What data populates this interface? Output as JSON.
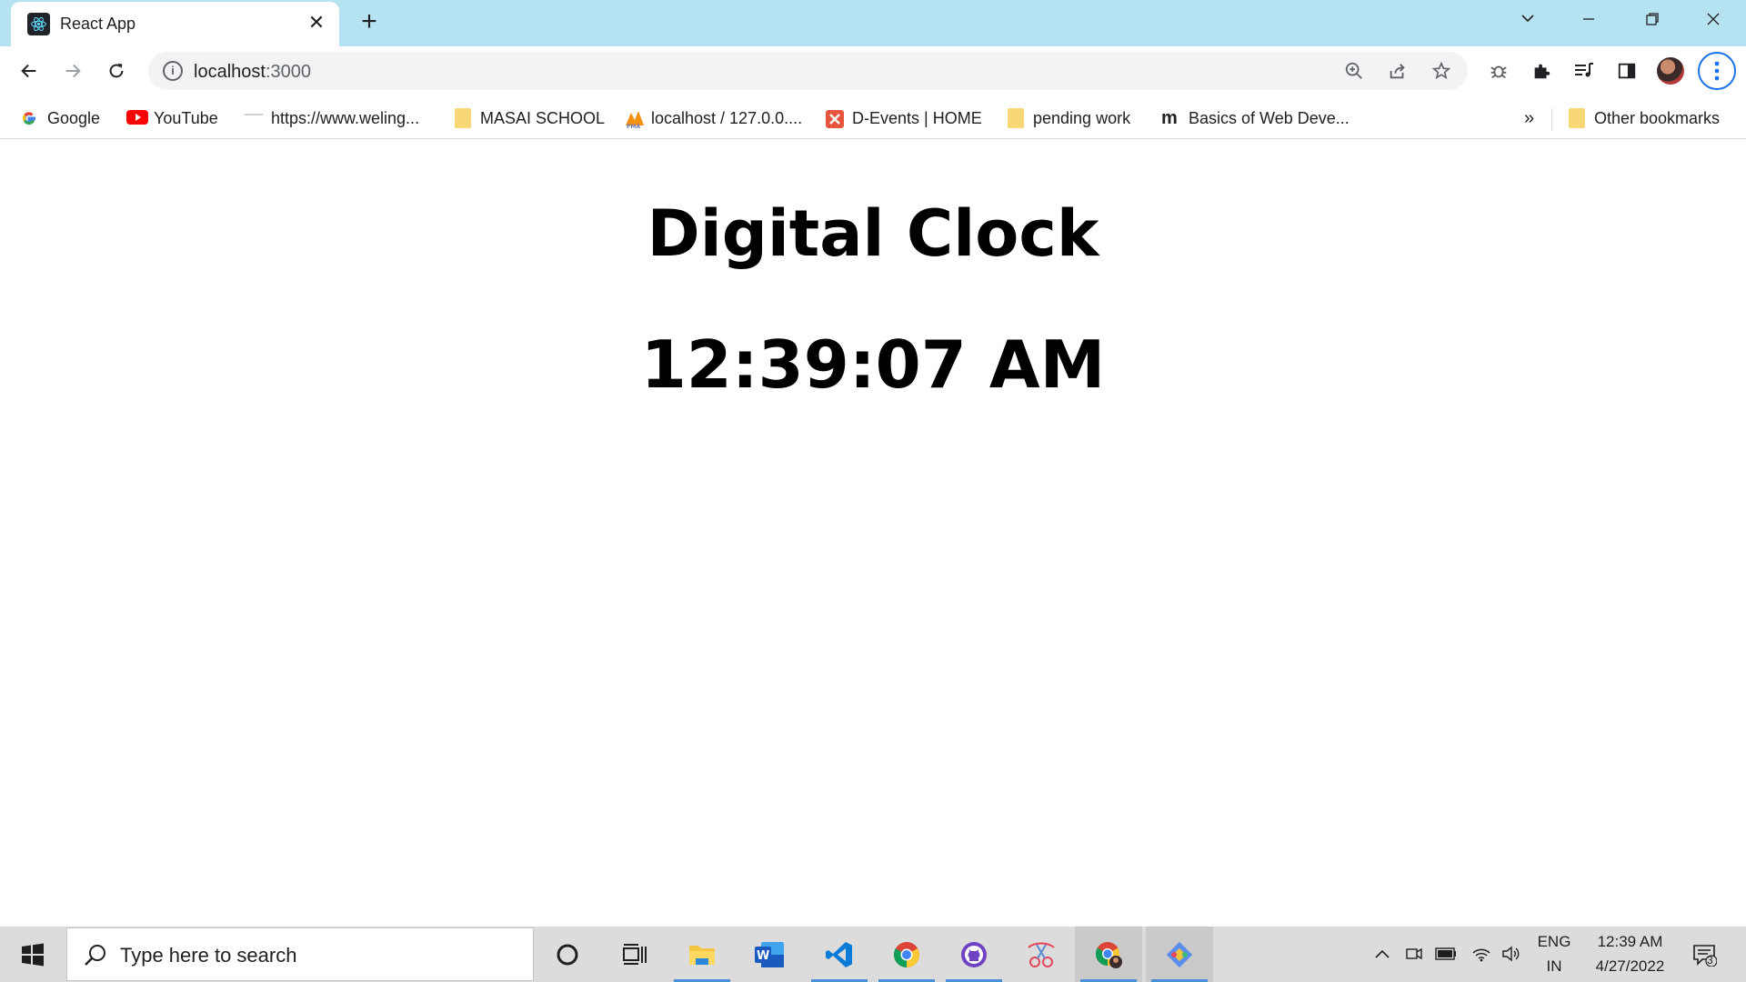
{
  "browser": {
    "tab": {
      "title": "React App"
    },
    "new_tab_label": "+",
    "window_controls": {
      "list": "⌄",
      "minimize": "—",
      "restore": "❐",
      "close": "✕"
    },
    "address": {
      "host": "localhost",
      "port": ":3000"
    },
    "bookmarks": [
      {
        "label": "Google",
        "icon": "google-icon"
      },
      {
        "label": "YouTube",
        "icon": "youtube-icon"
      },
      {
        "label": "https://www.weling...",
        "icon": "site-icon"
      },
      {
        "label": "MASAI SCHOOL",
        "icon": "folder-icon"
      },
      {
        "label": "localhost / 127.0.0....",
        "icon": "phpmyadmin-icon"
      },
      {
        "label": "D-Events | HOME",
        "icon": "d-events-icon"
      },
      {
        "label": "pending work",
        "icon": "folder-icon"
      },
      {
        "label": "Basics of Web Deve...",
        "icon": "medium-icon"
      }
    ],
    "bookmarks_overflow": "»",
    "other_bookmarks": "Other bookmarks"
  },
  "page": {
    "title": "Digital Clock",
    "time": "12:39:07 AM"
  },
  "taskbar": {
    "search_placeholder": "Type here to search",
    "apps": [
      "cortana",
      "task-view",
      "file-explorer",
      "word",
      "vscode",
      "chrome",
      "github-desktop",
      "snipping-tool",
      "chrome-profile",
      "git"
    ],
    "language": {
      "line1": "ENG",
      "line2": "IN"
    },
    "clock": {
      "time": "12:39 AM",
      "date": "4/27/2022"
    },
    "notification_count": "3"
  },
  "colors": {
    "tabstrip": "#b6e3f1",
    "taskbar": "#dcdcdc",
    "accent": "#1a73e8"
  }
}
